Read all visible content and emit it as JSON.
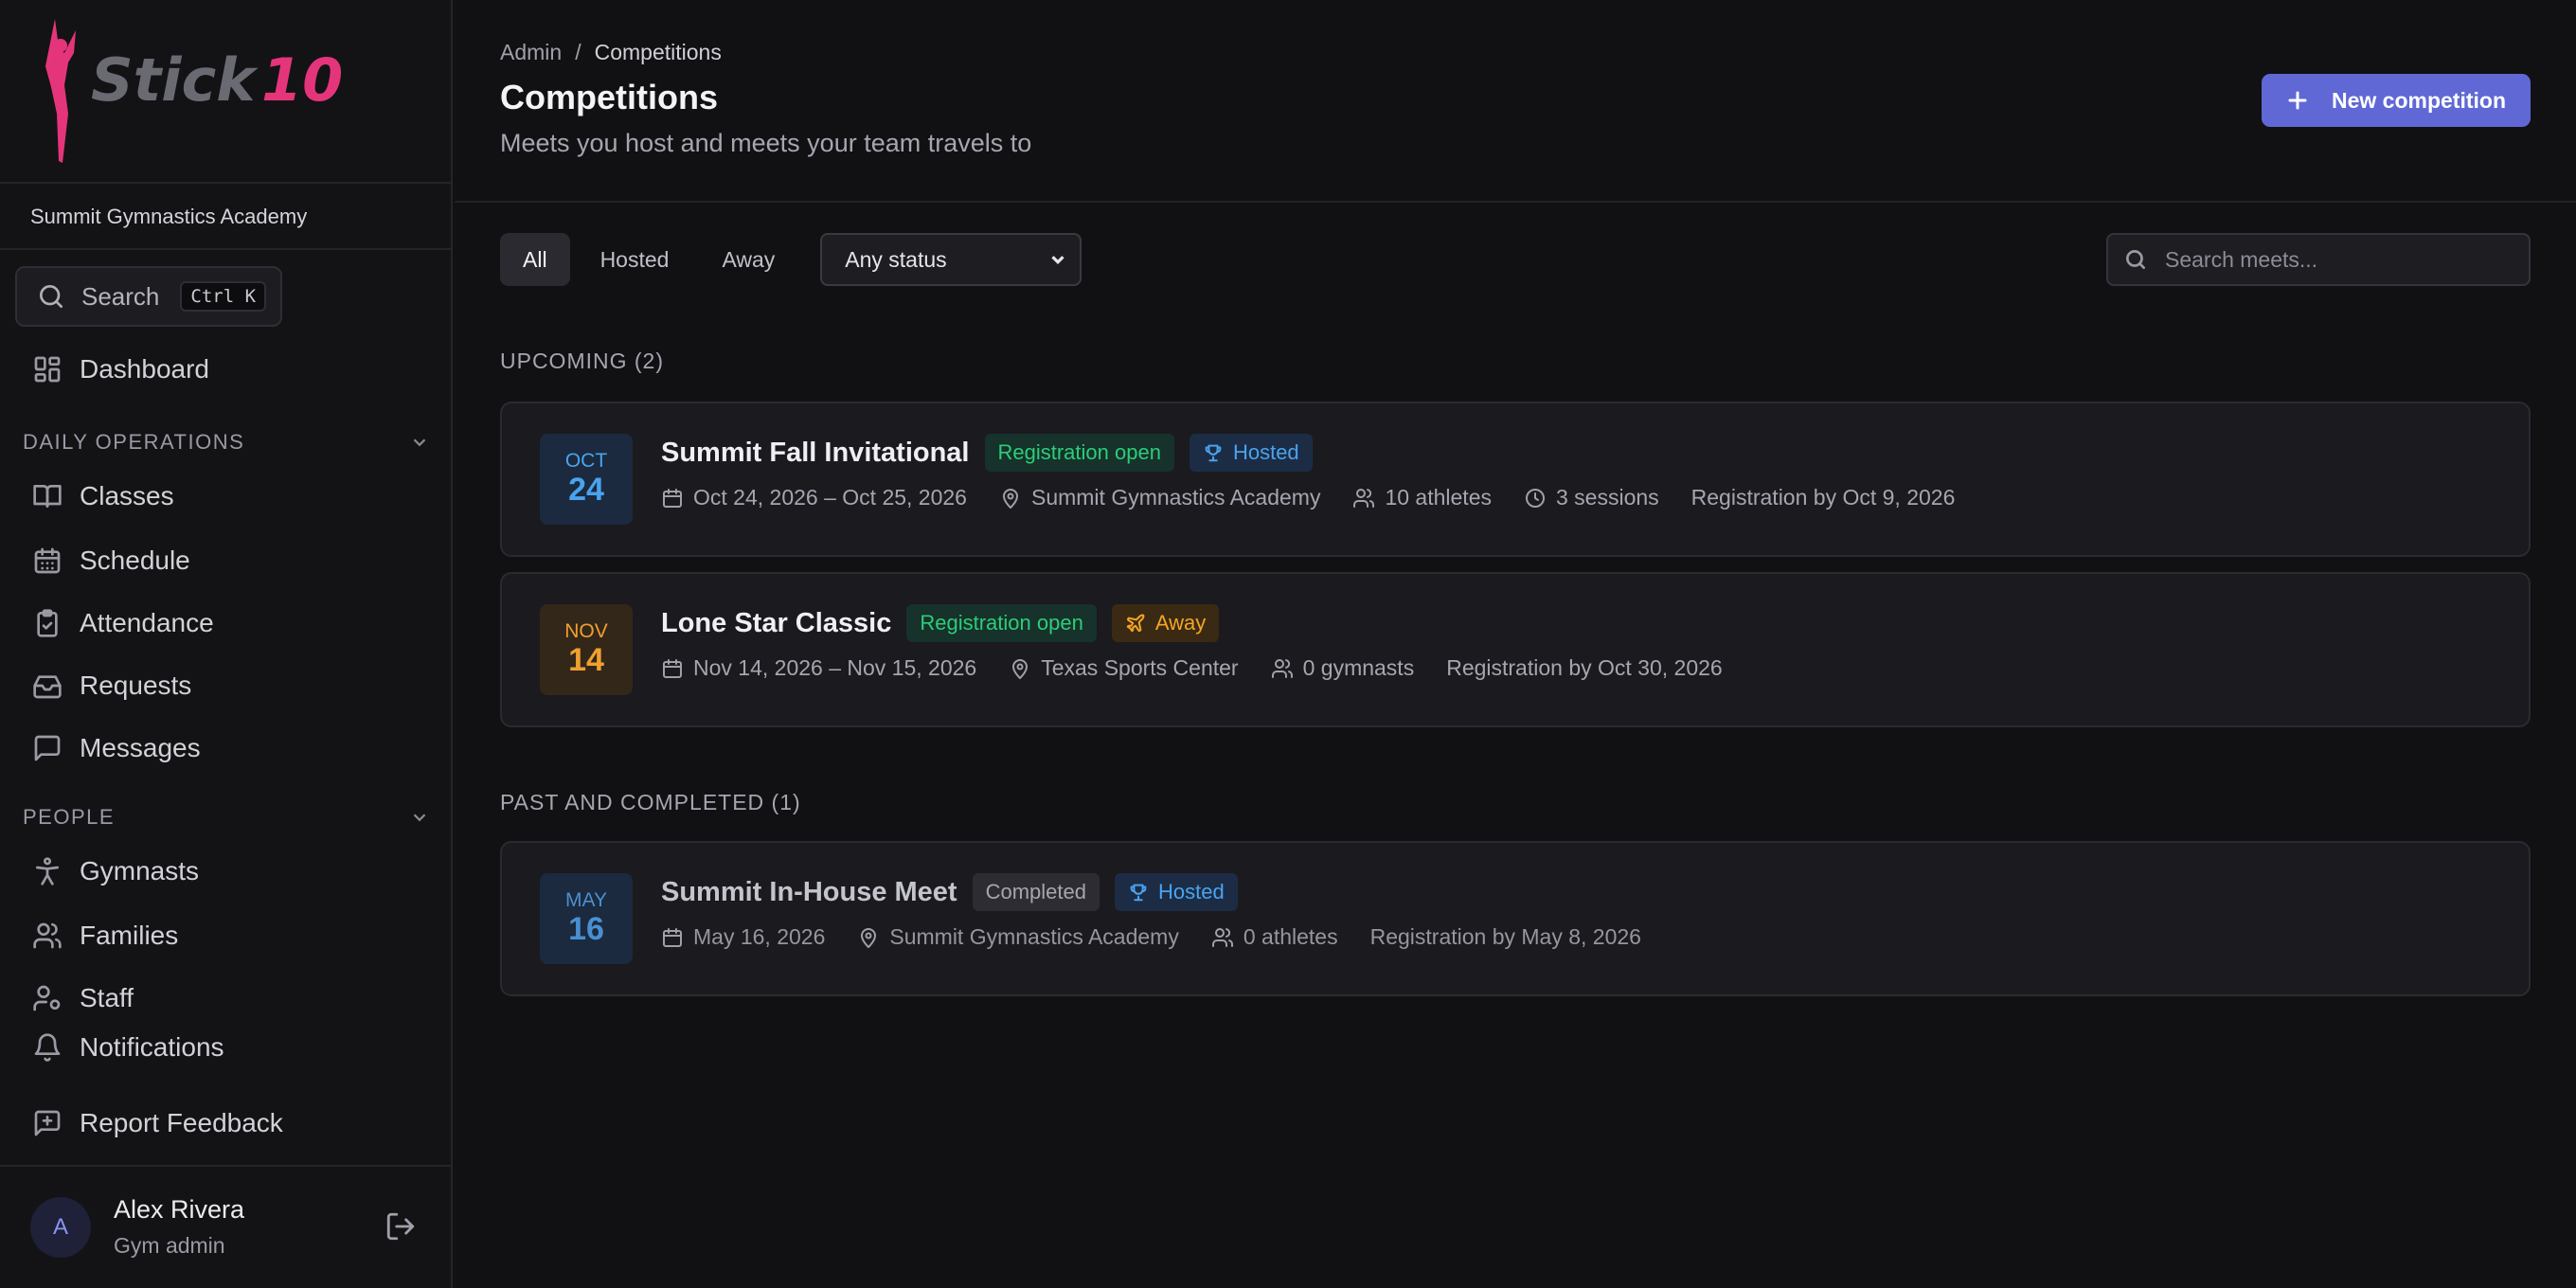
{
  "brand": {
    "logo_text": "Stick10"
  },
  "org_name": "Summit Gymnastics Academy",
  "sidebar": {
    "search_label": "Search",
    "search_shortcut": "Ctrl K",
    "dashboard": "Dashboard",
    "sections": [
      {
        "title": "DAILY OPERATIONS",
        "items": [
          "Classes",
          "Schedule",
          "Attendance",
          "Requests",
          "Messages"
        ]
      },
      {
        "title": "PEOPLE",
        "items": [
          "Gymnasts",
          "Families",
          "Staff"
        ]
      }
    ],
    "notifications": "Notifications",
    "report_feedback": "Report Feedback"
  },
  "user": {
    "initial": "A",
    "name": "Alex Rivera",
    "role": "Gym admin"
  },
  "header": {
    "breadcrumb": [
      "Admin",
      "/",
      "Competitions"
    ],
    "title": "Competitions",
    "subtitle": "Meets you host and meets your team travels to",
    "new_button": "New competition"
  },
  "filters": {
    "tabs": [
      "All",
      "Hosted",
      "Away"
    ],
    "active_tab": "All",
    "status_select": "Any status",
    "search_placeholder": "Search meets..."
  },
  "sections": {
    "upcoming": "UPCOMING (2)",
    "past": "PAST AND COMPLETED (1)"
  },
  "competitions": [
    {
      "month": "OCT",
      "day": "24",
      "name": "Summit Fall Invitational",
      "status": "Registration open",
      "type": "Hosted",
      "dates": "Oct 24, 2026 – Oct 25, 2026",
      "location": "Summit Gymnastics Academy",
      "count": "10 athletes",
      "sessions": "3 sessions",
      "deadline": "Registration by Oct 9, 2026"
    },
    {
      "month": "NOV",
      "day": "14",
      "name": "Lone Star Classic",
      "status": "Registration open",
      "type": "Away",
      "dates": "Nov 14, 2026 – Nov 15, 2026",
      "location": "Texas Sports Center",
      "count": "0 gymnasts",
      "deadline": "Registration by Oct 30, 2026"
    },
    {
      "month": "MAY",
      "day": "16",
      "name": "Summit In-House Meet",
      "status": "Completed",
      "type": "Hosted",
      "dates": "May 16, 2026",
      "location": "Summit Gymnastics Academy",
      "count": "0 athletes",
      "deadline": "Registration by May 8, 2026"
    }
  ],
  "colors": {
    "accent": "#6068d6",
    "brand_pink": "#e5357a",
    "green": "#2ecc7a",
    "blue": "#4aa3f0",
    "amber": "#f5a623"
  }
}
